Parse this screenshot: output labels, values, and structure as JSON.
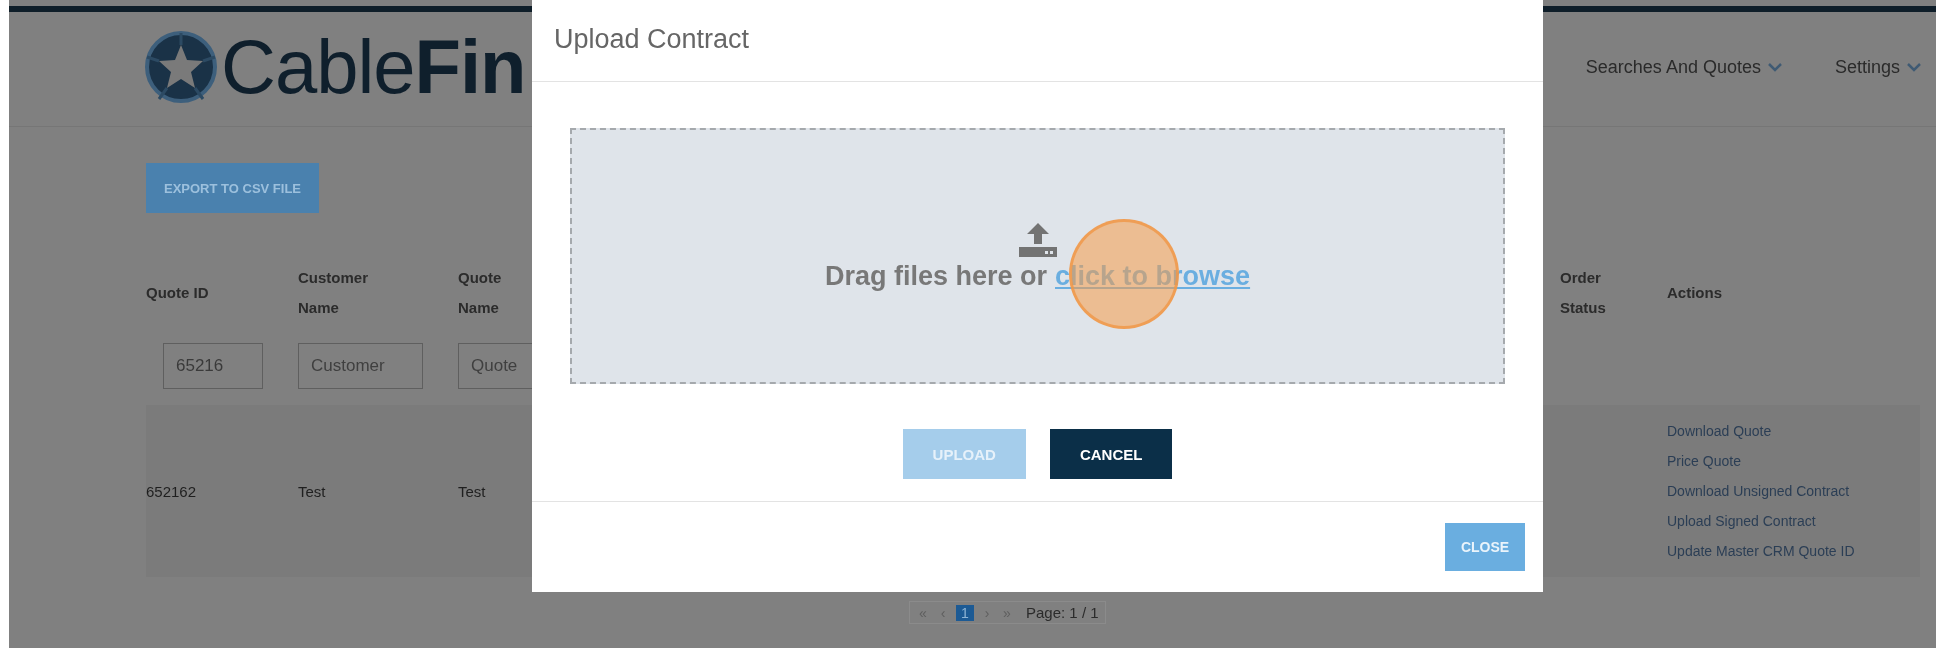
{
  "header": {
    "logo": "Cable**Fin**",
    "nav": [
      {
        "label": "Searches And Quotes"
      },
      {
        "label": "Settings"
      }
    ]
  },
  "export_button": "EXPORT TO CSV FILE",
  "table": {
    "columns": [
      "Quote ID",
      "Customer Name",
      "Quote Name",
      "Order Status",
      "Actions"
    ],
    "filters": [
      {
        "value": "65216"
      },
      {
        "placeholder": "Customer"
      },
      {
        "placeholder": "Quote"
      }
    ],
    "rows": [
      {
        "quote_id": "652162",
        "customer_name": "Test",
        "quote_name": "Test",
        "actions": [
          "Download Quote",
          "Price Quote",
          "Download Unsigned Contract",
          "Upload Signed Contract",
          "Update Master CRM Quote ID"
        ]
      }
    ]
  },
  "pagination": {
    "nav_first": "«",
    "nav_prev": "‹",
    "pages": [
      {
        "label": "1",
        "selected": true
      }
    ],
    "nav_next": "›",
    "nav_last": "»",
    "page_info": "Page: 1 / 1"
  },
  "modal": {
    "title": "Upload Contract",
    "dropzone": {
      "text": "Drag files here or",
      "link": "click to browse",
      "cursor_highlight": true
    },
    "buttons": [
      {
        "label": "UPLOAD",
        "kind": "upload",
        "disabled": true
      },
      {
        "label": "CANCEL",
        "kind": "cancel",
        "disabled": false
      }
    ],
    "footer_button": "CLOSE"
  }
}
